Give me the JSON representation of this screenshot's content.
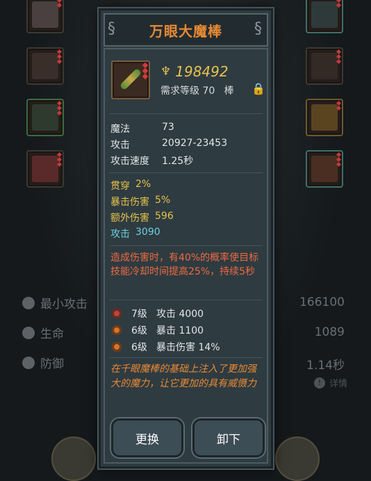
{
  "item": {
    "name": "万眼大魔棒",
    "power": "198492",
    "requirement": "需求等级 70",
    "type": "棒"
  },
  "base_stats": [
    {
      "label": "魔法",
      "value": "73"
    },
    {
      "label": "攻击",
      "value": "20927-23453"
    },
    {
      "label": "攻击速度",
      "value": "1.25秒"
    }
  ],
  "bonus_stats": [
    {
      "label": "贯穿",
      "value": "2%"
    },
    {
      "label": "暴击伤害",
      "value": "5%"
    },
    {
      "label": "额外伤害",
      "value": "596"
    }
  ],
  "extra_stat": {
    "label": "攻击",
    "value": "3090"
  },
  "special_effect": "造成伤害时，有40%的概率使目标技能冷却时间提高25%，持续5秒",
  "gems": [
    {
      "level": "7级",
      "effect": "攻击 4000"
    },
    {
      "level": "6级",
      "effect": "暴击 1100"
    },
    {
      "level": "6级",
      "effect": "暴击伤害 14%"
    }
  ],
  "flavor_text": "在千眼魔棒的基础上注入了更加强大的魔力，让它更加的具有威慑力",
  "buttons": {
    "swap": "更换",
    "unequip": "卸下"
  },
  "background_stats": [
    {
      "label": "最小攻击",
      "value": "166100"
    },
    {
      "label": "生命",
      "value": "1089"
    },
    {
      "label": "防御",
      "value": "1.14秒"
    }
  ],
  "detail_link": "详情",
  "colors": {
    "title": "#e88a34",
    "power": "#e9c24e",
    "bonus": "#e6c349",
    "extra": "#6dd0e0",
    "effect": "#ef6a40",
    "panel": "#2e3b41"
  }
}
